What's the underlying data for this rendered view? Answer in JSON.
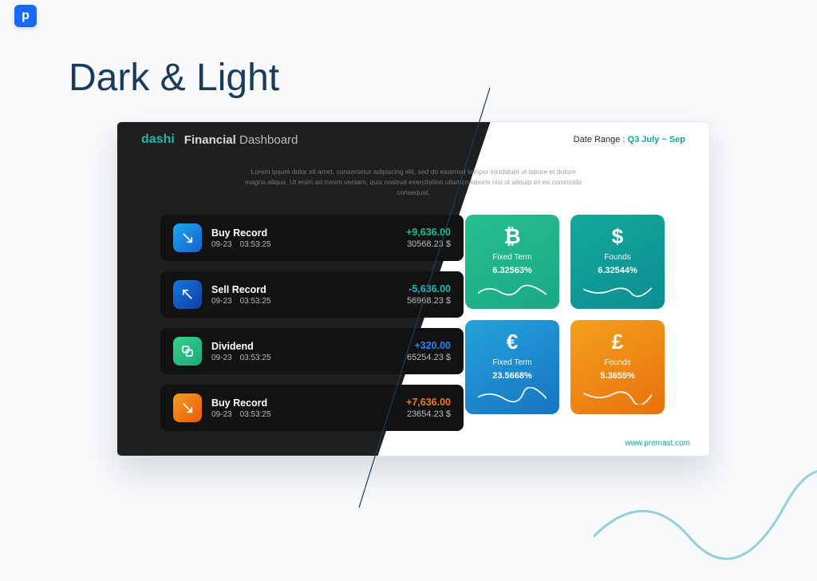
{
  "page": {
    "title": "Dark & Light"
  },
  "header": {
    "logo_text": "dashi",
    "financial_bold": "Financial",
    "financial_light": "Dashboard",
    "date_label": "Date Range : ",
    "date_q": "Q3",
    "date_rest": " July ~ Sep"
  },
  "lorem": "Lorem ipsum dolor sit amet, consectetur adipiscing elit, sed do eiusmod tempor incididunt ut labore et dolore magna aliqua. Ut enim ad minim veniam, quis nostrud exercitation ullamco laboris nisi ut aliquip ex ea commodo consequat.",
  "records": [
    {
      "title": "Buy Record",
      "date": "09-23",
      "time": "03:53:25",
      "delta": "+9,636.00",
      "delta_class": "d-green",
      "amount": "30568.23 $",
      "icon": "arrow-down-right",
      "icon_class": "ic-grad-a"
    },
    {
      "title": "Sell Record",
      "date": "09-23",
      "time": "03:53:25",
      "delta": "-5,636.00",
      "delta_class": "d-teal",
      "amount": "56968.23 $",
      "icon": "arrow-up-left",
      "icon_class": "ic-grad-b"
    },
    {
      "title": "Dividend",
      "date": "09-23",
      "time": "03:53:25",
      "delta": "+320.00",
      "delta_class": "d-blue",
      "amount": "65254.23 $",
      "icon": "swap",
      "icon_class": "ic-grad-c"
    },
    {
      "title": "Buy Record",
      "date": "09-23",
      "time": "03:53:25",
      "delta": "+7,636.00",
      "delta_class": "d-orange",
      "amount": "23654.23 $",
      "icon": "arrow-down-right",
      "icon_class": "ic-grad-d"
    }
  ],
  "tiles": [
    {
      "symbol": "₿",
      "label": "Fixed Term",
      "percent": "6.32563%",
      "tile_class": "t1"
    },
    {
      "symbol": "$",
      "label": "Founds",
      "percent": "6.32544%",
      "tile_class": "t2"
    },
    {
      "symbol": "€",
      "label": "Fixed Term",
      "percent": "23.5668%",
      "tile_class": "t3"
    },
    {
      "symbol": "£",
      "label": "Founds",
      "percent": "5.3655%",
      "tile_class": "t4"
    }
  ],
  "footer_url": "www.premast.com"
}
